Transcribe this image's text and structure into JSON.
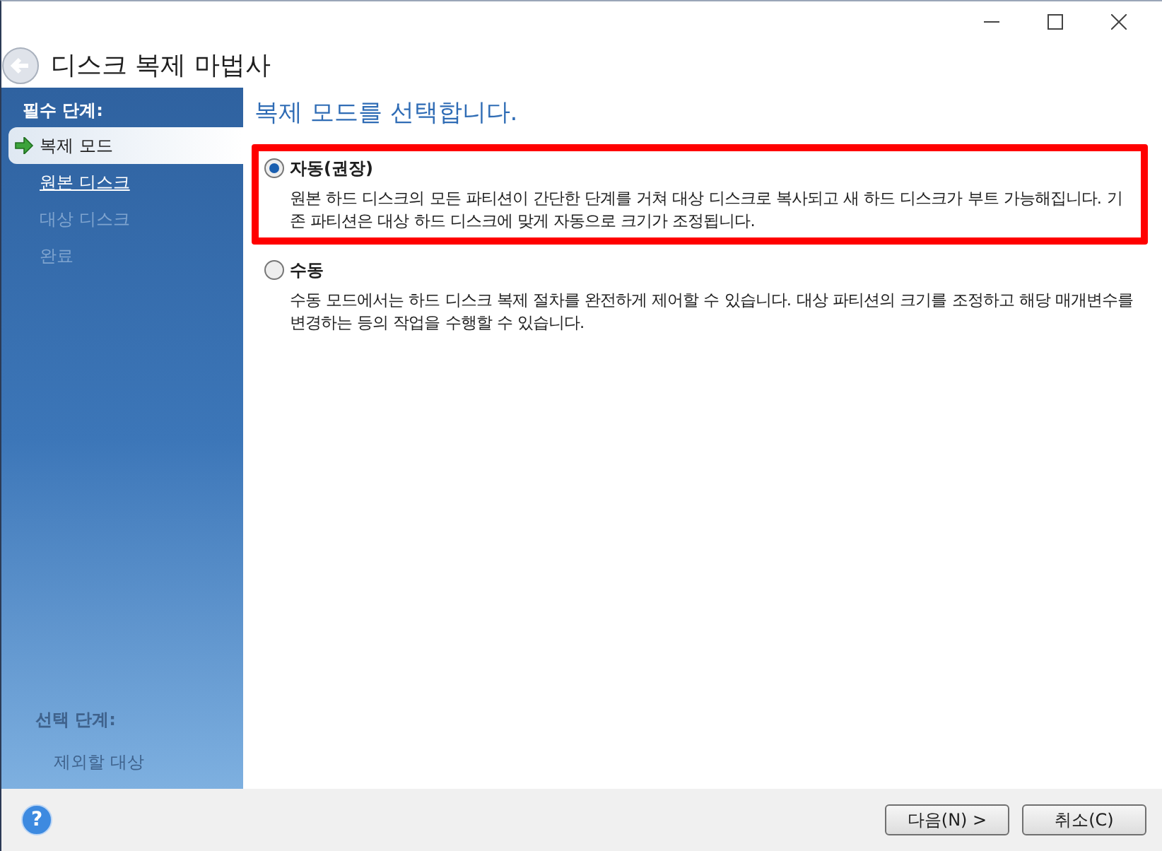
{
  "window": {
    "title": "디스크 복제 마법사"
  },
  "sidebar": {
    "required_heading": "필수 단계:",
    "steps": [
      {
        "label": "복제 모드",
        "selected": true,
        "disabled": false
      },
      {
        "label": "원본 디스크",
        "selected": false,
        "disabled": false
      },
      {
        "label": "대상 디스크",
        "selected": false,
        "disabled": true
      },
      {
        "label": "완료",
        "selected": false,
        "disabled": true
      }
    ],
    "optional_heading": "선택 단계:",
    "optional_steps": [
      {
        "label": "제외할 대상",
        "disabled": true
      }
    ]
  },
  "content": {
    "heading": "복제 모드를 선택합니다.",
    "options": [
      {
        "label": "자동(권장)",
        "selected": true,
        "highlighted": true,
        "description": "원본 하드 디스크의 모든 파티션이 간단한 단계를 거쳐 대상 디스크로 복사되고 새 하드 디스크가 부트 가능해집니다. 기존 파티션은 대상 하드 디스크에 맞게 자동으로 크기가 조정됩니다."
      },
      {
        "label": "수동",
        "selected": false,
        "highlighted": false,
        "description": "수동 모드에서는 하드 디스크 복제 절차를 완전하게 제어할 수 있습니다. 대상 파티션의 크기를 조정하고 해당 매개변수를 변경하는 등의 작업을 수행할 수 있습니다."
      }
    ]
  },
  "help_button": "?",
  "buttons": [
    "다음(N) >",
    "취소(C)"
  ]
}
